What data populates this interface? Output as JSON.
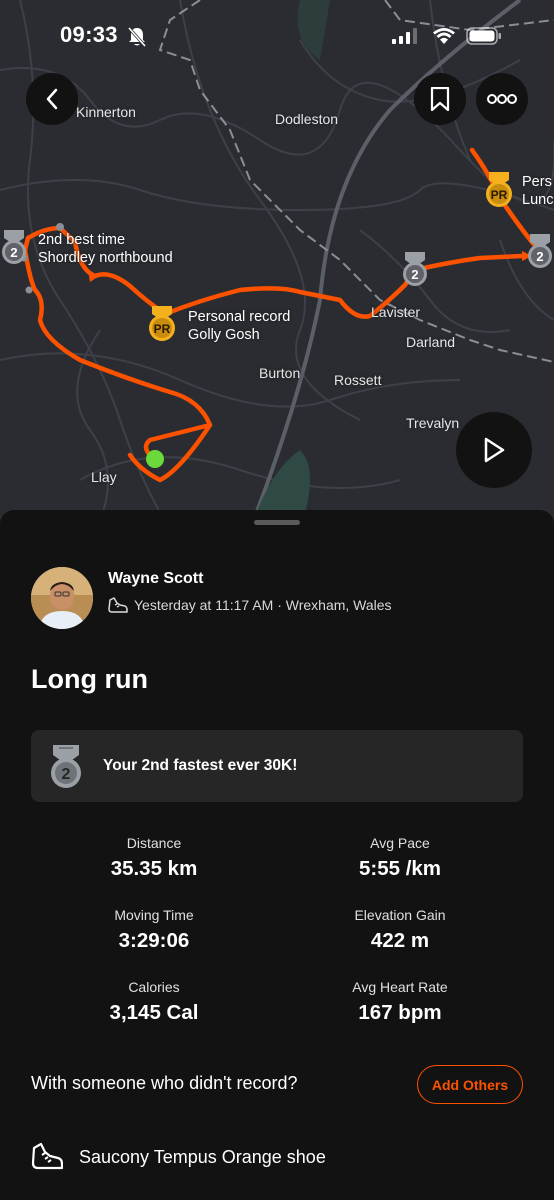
{
  "status_bar": {
    "time": "09:33"
  },
  "map": {
    "places": [
      "Kinnerton",
      "Dodleston",
      "Lavister",
      "Darland",
      "Burton",
      "Rossett",
      "Trevalyn",
      "Llay"
    ],
    "segments": [
      {
        "line1": "2nd best time",
        "line2": "Shordley northbound"
      },
      {
        "line1": "Personal record",
        "line2": "Golly Gosh"
      },
      {
        "line1": "Pers",
        "line2": "Lunc"
      }
    ],
    "colors": {
      "route": "#fc5200",
      "start_dot": "#6bd93a",
      "background": "#2a2c31"
    }
  },
  "activity": {
    "athlete_name": "Wayne Scott",
    "meta": "Yesterday at 11:17 AM · Wrexham, Wales",
    "title": "Long run",
    "achievement": "Your 2nd fastest ever 30K!",
    "stats": [
      {
        "label": "Distance",
        "value": "35.35 km"
      },
      {
        "label": "Avg Pace",
        "value": "5:55 /km"
      },
      {
        "label": "Moving Time",
        "value": "3:29:06"
      },
      {
        "label": "Elevation Gain",
        "value": "422 m"
      },
      {
        "label": "Calories",
        "value": "3,145 Cal"
      },
      {
        "label": "Avg Heart Rate",
        "value": "167 bpm"
      }
    ],
    "with_others_prompt": "With someone who didn't record?",
    "add_others_label": "Add Others",
    "gear": "Saucony Tempus Orange shoe"
  },
  "badges": {
    "pr": "PR",
    "second": "2"
  }
}
